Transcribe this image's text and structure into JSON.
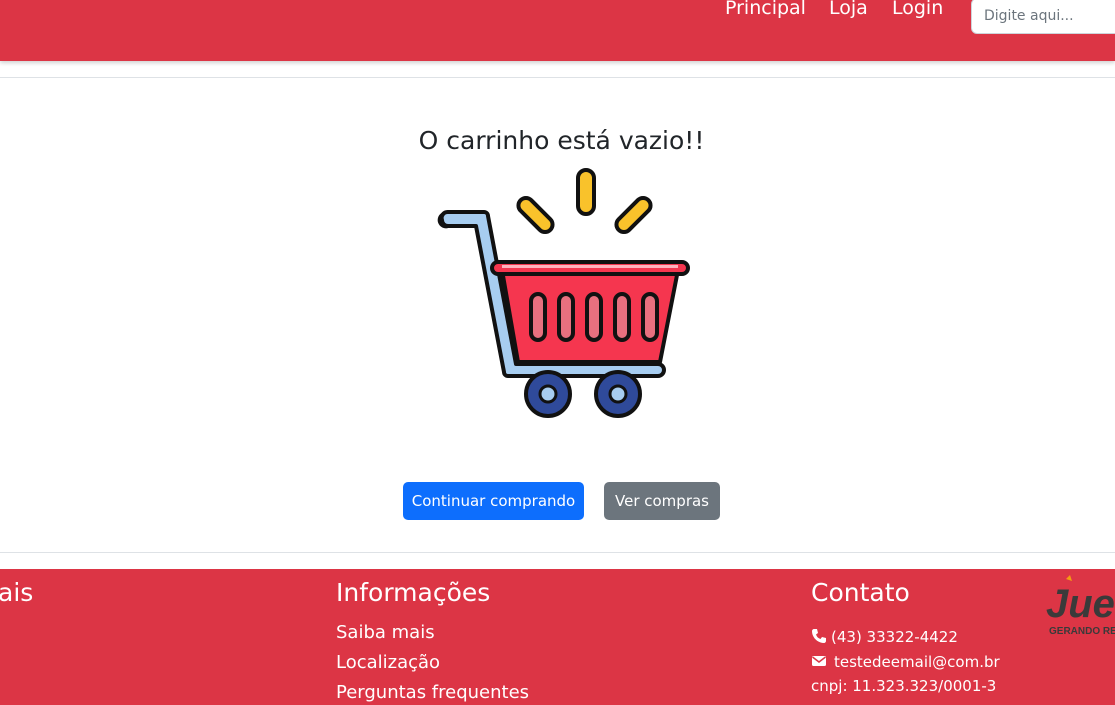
{
  "header": {
    "nav": [
      {
        "label": "Principal"
      },
      {
        "label": "Loja"
      },
      {
        "label": "Login"
      }
    ],
    "search": {
      "placeholder": "Digite aqui..."
    }
  },
  "main": {
    "title": "O carrinho está vazio!!",
    "cart_icon": "shopping-cart-icon",
    "buttons": {
      "continue_label": "Continuar comprando",
      "view_label": "Ver compras"
    }
  },
  "footer": {
    "col1": {
      "heading_fragment": "ais"
    },
    "informacoes": {
      "heading": "Informações",
      "links": [
        "Saiba mais",
        "Localização",
        "Perguntas frequentes"
      ]
    },
    "contato": {
      "heading": "Contato",
      "phone": "(43) 33322-4422",
      "email": "testedeemail@com.br",
      "cnpj": "cnpj: 11.323.323/0001-3"
    },
    "logo": {
      "text": "Jue",
      "tagline": "GERANDO RE"
    }
  },
  "colors": {
    "brand_red": "#dc3545",
    "primary_blue": "#0d6efd",
    "secondary_gray": "#6c757d",
    "cart_red": "#f5364f",
    "spark_yellow": "#f9c22b",
    "wheel_blue": "#2f4a9a"
  }
}
